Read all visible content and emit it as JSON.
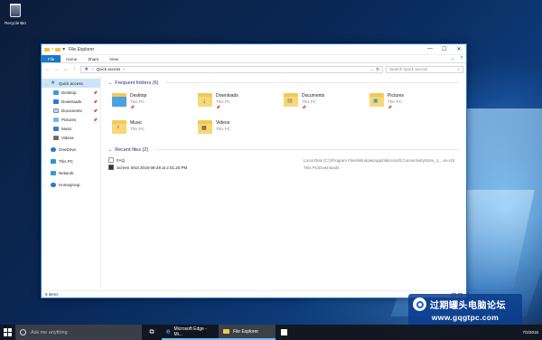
{
  "desktop": {
    "recycle_bin_label": "Recycle Bin"
  },
  "window": {
    "title": "File Explorer",
    "controls": {
      "minimize": "—",
      "maximize": "☐",
      "close": "✕"
    },
    "ribbon_tabs": [
      "File",
      "Home",
      "Share",
      "View"
    ],
    "address": {
      "location": "Quick access",
      "separator": "›"
    },
    "search": {
      "placeholder": "Search Quick access"
    },
    "nav": {
      "items": [
        {
          "label": "Quick access",
          "icon": "star-icon",
          "selected": true
        },
        {
          "label": "Desktop",
          "icon": "desktop-icon",
          "pinned": true
        },
        {
          "label": "Downloads",
          "icon": "downloads-icon",
          "pinned": true
        },
        {
          "label": "Documents",
          "icon": "documents-icon",
          "pinned": true
        },
        {
          "label": "Pictures",
          "icon": "pictures-icon",
          "pinned": true
        },
        {
          "label": "Music",
          "icon": "music-icon"
        },
        {
          "label": "Videos",
          "icon": "videos-icon"
        },
        {
          "label": "OneDrive",
          "icon": "onedrive-icon"
        },
        {
          "label": "This PC",
          "icon": "this-pc-icon"
        },
        {
          "label": "Network",
          "icon": "network-icon"
        },
        {
          "label": "Homegroup",
          "icon": "homegroup-icon"
        }
      ]
    },
    "frequent": {
      "header": "Frequent folders (6)",
      "folders": [
        {
          "name": "Desktop",
          "location": "This PC",
          "pinned": true
        },
        {
          "name": "Downloads",
          "location": "This PC",
          "pinned": true
        },
        {
          "name": "Documents",
          "location": "This PC",
          "pinned": true
        },
        {
          "name": "Pictures",
          "location": "This PC",
          "pinned": true
        },
        {
          "name": "Music",
          "location": "This PC"
        },
        {
          "name": "Videos",
          "location": "This PC"
        }
      ]
    },
    "recent": {
      "header": "Recent files (2)",
      "files": [
        {
          "name": "FAQ",
          "path": "Local Disk (C:)\\Program Files\\WindowsApps\\Microsoft.ConnectivityStore_1....en-US"
        },
        {
          "name": "Screen Shot 2015-06-28 at 2.01.20 PM",
          "path": "This PC\\Downloads"
        }
      ]
    },
    "status": "8 items"
  },
  "taskbar": {
    "search_placeholder": "Ask me anything",
    "apps": [
      {
        "label": "Microsoft Edge - Mi...",
        "icon": "edge-icon"
      },
      {
        "label": "File Explorer",
        "icon": "folder-icon",
        "active": true
      }
    ],
    "tray": {
      "time": "",
      "date": "7/2/2015"
    }
  },
  "watermark": {
    "title": "过期罐头电脑论坛",
    "url": "www.gqgtpc.com"
  }
}
